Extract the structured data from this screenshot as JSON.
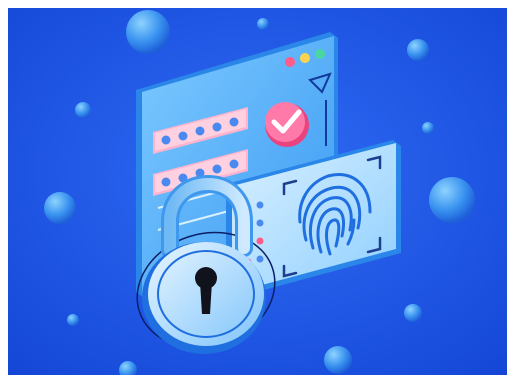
{
  "scene": {
    "description_free": true,
    "palette": {
      "background": "#1a4fe0",
      "background_light": "#2f6cf5",
      "panel": "#56b2f5",
      "panel_light": "#8ed3ff",
      "panel_edge": "#2a86e8",
      "pink": "#ff7aa8",
      "pink_dark": "#e9447f",
      "white": "#eef6ff",
      "dot_red": "#ff5c8a",
      "dot_yellow": "#ffd34d",
      "dot_green": "#49d6a0",
      "keyhole": "#10121c"
    },
    "icons": {
      "padlock": "padlock-icon",
      "checkmark": "checkmark-icon",
      "fingerprint": "fingerprint-icon",
      "triangle": "triangle-icon",
      "password_dots": "password-asterisk-icon"
    }
  }
}
